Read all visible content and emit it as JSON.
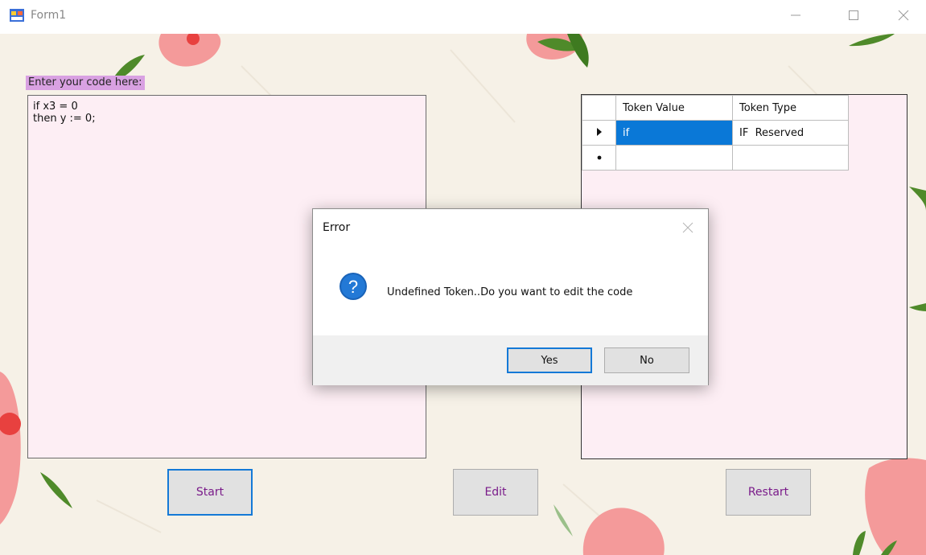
{
  "window": {
    "title": "Form1",
    "icon": "winforms-app-icon",
    "controls": [
      "minimize-icon",
      "maximize-icon",
      "close-icon"
    ]
  },
  "form": {
    "code_label": "Enter your code here:",
    "code_text": "if x3 = 0\nthen y := 0;",
    "grid": {
      "columns": [
        "Token Value",
        "Token Type"
      ],
      "rows": [
        {
          "indicator": "current-row-arrow",
          "token_value": "if",
          "token_type": "IF  Reserved",
          "selected_cell": "token_value"
        },
        {
          "indicator": "new-row-asterisk",
          "token_value": "",
          "token_type": ""
        }
      ]
    },
    "buttons": {
      "start": "Start",
      "edit": "Edit",
      "restart": "Restart"
    }
  },
  "dialog": {
    "title": "Error",
    "message": "Undefined Token..Do you want to edit the code",
    "icon": "question-icon",
    "buttons": {
      "yes": "Yes",
      "no": "No"
    }
  },
  "colors": {
    "label_bg": "#d9a1e2",
    "panel_bg": "#fdeef4",
    "selection": "#0a78d7",
    "button_text": "#7a1c8a",
    "focus_border": "#1479d7"
  }
}
